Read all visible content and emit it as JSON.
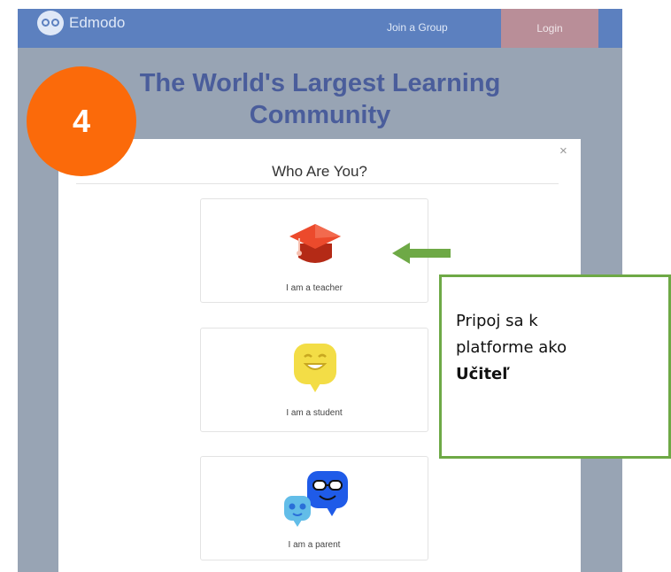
{
  "header": {
    "logo_text": "Edmodo",
    "join_label": "Join a Group",
    "login_label": "Login",
    "bar_color": "#5c80bf"
  },
  "hero": {
    "title_line1": "The World's Largest Learning",
    "title_line2": "Community"
  },
  "step_badge": {
    "number": "4",
    "color": "#fb6a0a"
  },
  "modal": {
    "title": "Who Are You?",
    "close_symbol": "×",
    "options": [
      {
        "label": "I am a teacher",
        "icon": "graduation-cap-icon"
      },
      {
        "label": "I am a student",
        "icon": "student-smiley-icon"
      },
      {
        "label": "I am a parent",
        "icon": "parent-characters-icon"
      }
    ]
  },
  "annotation": {
    "arrow_color": "#6ea946",
    "line1": "Pripoj sa k",
    "line2": "platforme ako",
    "line3": "Učiteľ"
  }
}
